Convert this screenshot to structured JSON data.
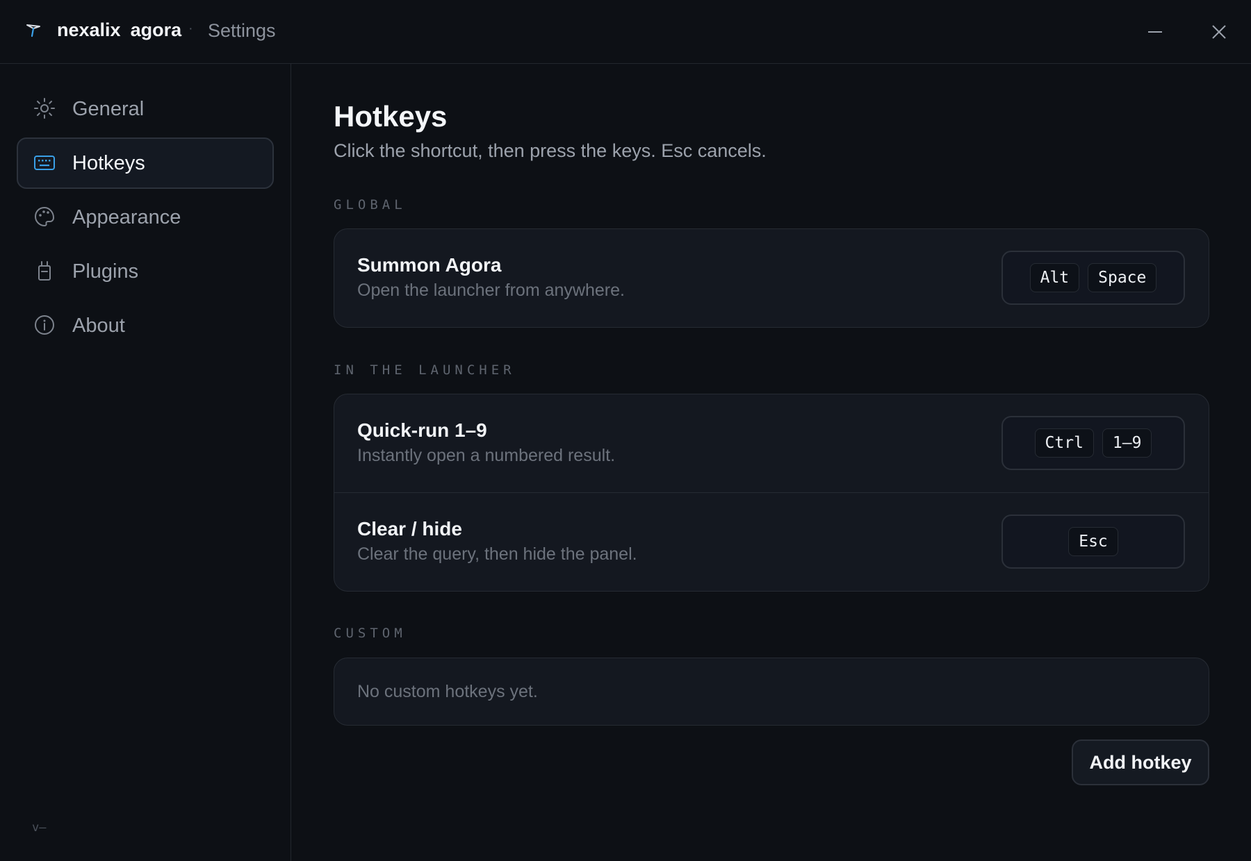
{
  "titlebar": {
    "brand_part1": "nexalix",
    "brand_part2": "agora",
    "separator": "·",
    "crumb": "Settings"
  },
  "sidebar": {
    "items": [
      {
        "label": "General",
        "icon": "sun-icon",
        "active": false
      },
      {
        "label": "Hotkeys",
        "icon": "keyboard-icon",
        "active": true
      },
      {
        "label": "Appearance",
        "icon": "palette-icon",
        "active": false
      },
      {
        "label": "Plugins",
        "icon": "plug-icon",
        "active": false
      },
      {
        "label": "About",
        "icon": "info-icon",
        "active": false
      }
    ],
    "version": "v—"
  },
  "main": {
    "title": "Hotkeys",
    "subtitle": "Click the shortcut, then press the keys. Esc cancels.",
    "sections": [
      {
        "label": "GLOBAL",
        "rows": [
          {
            "title": "Summon Agora",
            "description": "Open the launcher from anywhere.",
            "keys": [
              "Alt",
              "Space"
            ]
          }
        ]
      },
      {
        "label": "IN THE LAUNCHER",
        "rows": [
          {
            "title": "Quick-run 1–9",
            "description": "Instantly open a numbered result.",
            "keys": [
              "Ctrl",
              "1–9"
            ]
          },
          {
            "title": "Clear / hide",
            "description": "Clear the query, then hide the panel.",
            "keys": [
              "Esc"
            ]
          }
        ]
      },
      {
        "label": "CUSTOM",
        "empty_text": "No custom hotkeys yet."
      }
    ],
    "add_button": "Add hotkey"
  },
  "colors": {
    "background": "#0d1015",
    "card": "#141820",
    "accent": "#3aa0e8",
    "text_primary": "#f2f4f7",
    "text_muted": "#6c727c"
  }
}
